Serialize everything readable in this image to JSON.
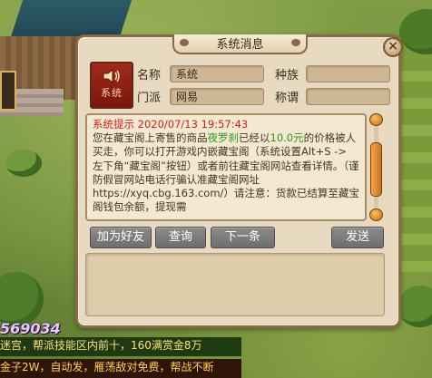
{
  "dialog": {
    "title": "系统消息",
    "close_label": "×",
    "avatar_label": "系统",
    "fields": {
      "name_label": "名称",
      "name_value": "系统",
      "faction_label": "门派",
      "faction_value": "网易",
      "race_label": "种族",
      "race_value": "",
      "title_label": "称谓",
      "title_value": ""
    },
    "message": {
      "header": "系统提示 2020/07/13 19:57:43",
      "p1": "您在藏宝阁上寄售的商品",
      "item": "夜罗刹",
      "p2": "已经以",
      "price": "10.0元",
      "p3": "的价格被人买走，你可以打开游戏内嵌藏宝阁（系统设置Alt+S -> 左下角“藏宝阁”按钮）或者前往藏宝阁网站查看详情。（谨防假冒网站电话行骗认准藏宝阁网址 https://xyq.cbg.163.com/）请注意：货款已结算至藏宝阁钱包余额，提现需"
    },
    "buttons": {
      "add_friend": "加为好友",
      "inspect": "查询",
      "next": "下一条",
      "send": "发送"
    },
    "input_value": ""
  },
  "chat": {
    "number": "569034",
    "line1": "迷宫，帮派技能区内前十，160满赏金8万",
    "line2": "金子2W，自动发，雁荡敌对免费，帮战不断"
  },
  "colors": {
    "dialog_bg": "#e8dac0",
    "frame": "#8a6a46",
    "header_red": "#d0201a",
    "highlight_green": "#2b9a1e",
    "button_gray": "#7a7a7a"
  },
  "icons": [
    "speaker-icon",
    "close-icon",
    "scroll-up-icon",
    "scroll-down-icon"
  ]
}
